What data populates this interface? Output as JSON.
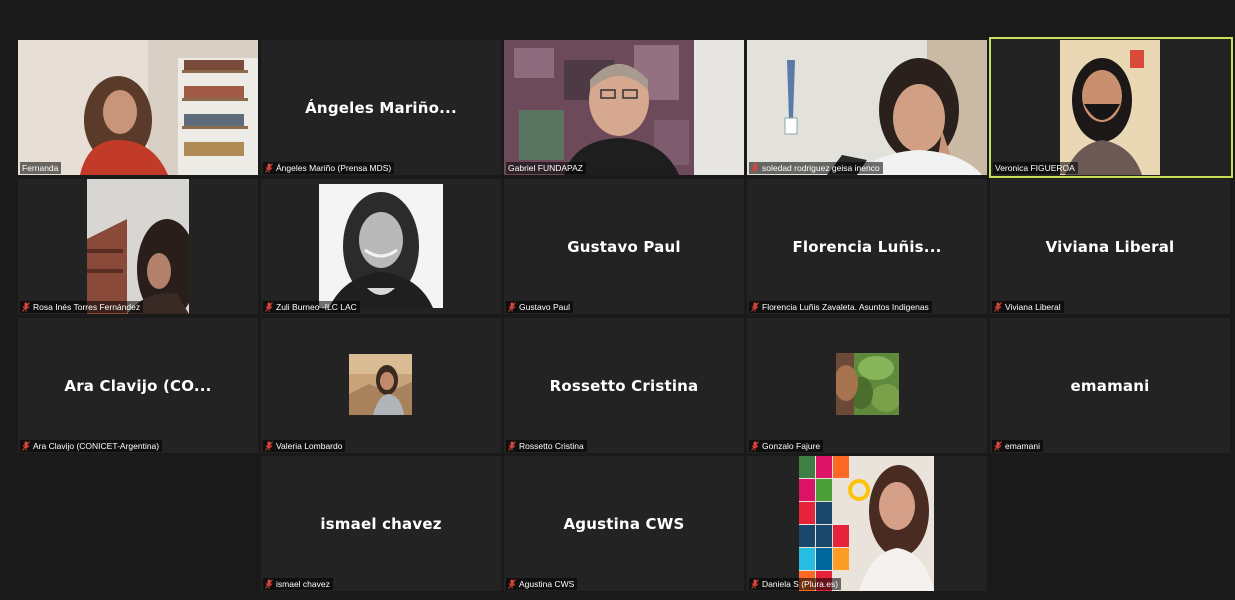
{
  "meeting": {
    "participants": [
      {
        "tile_name": "",
        "label": "Fernanda",
        "muted": false,
        "has_video": true
      },
      {
        "tile_name": "Ángeles  Mariño...",
        "label": "Ángeles Mariño (Prensa MDS)",
        "muted": true,
        "has_video": false
      },
      {
        "tile_name": "",
        "label": "Gabriel FUNDAPAZ",
        "muted": false,
        "has_video": true
      },
      {
        "tile_name": "",
        "label": "soledad rodriguez geisa inenco",
        "muted": true,
        "has_video": true
      },
      {
        "tile_name": "",
        "label": "Veronica FIGUEROA",
        "muted": false,
        "has_video": true,
        "active_speaker": true
      },
      {
        "tile_name": "",
        "label": "Rosa Inés Torres Fernández",
        "muted": true,
        "has_video": true
      },
      {
        "tile_name": "",
        "label": "Zuli Burneo -ILC LAC",
        "muted": true,
        "has_video": true
      },
      {
        "tile_name": "Gustavo Paul",
        "label": "Gustavo Paul",
        "muted": true,
        "has_video": false
      },
      {
        "tile_name": "Florencia  Luñis...",
        "label": "Florencia Luñis Zavaleta. Asuntos Indigenas",
        "muted": true,
        "has_video": false
      },
      {
        "tile_name": "Viviana Liberal",
        "label": "Viviana Liberal",
        "muted": true,
        "has_video": false
      },
      {
        "tile_name": "Ara Clavijo (CO...",
        "label": "Ara Clavijo (CONICET-Argentina)",
        "muted": true,
        "has_video": false
      },
      {
        "tile_name": "",
        "label": "Valeria Lombardo",
        "muted": true,
        "has_video": false,
        "profile_picture": true
      },
      {
        "tile_name": "Rossetto Cristina",
        "label": "Rossetto Cristina",
        "muted": true,
        "has_video": false
      },
      {
        "tile_name": "",
        "label": "Gonzalo Fajure",
        "muted": true,
        "has_video": false,
        "profile_picture": true
      },
      {
        "tile_name": "emamani",
        "label": "emamani",
        "muted": true,
        "has_video": false
      },
      {
        "tile_name": "ismael chavez",
        "label": "ismael chavez",
        "muted": true,
        "has_video": false
      },
      {
        "tile_name": "Agustina CWS",
        "label": "Agustina CWS",
        "muted": true,
        "has_video": false
      },
      {
        "tile_name": "",
        "label": "Daniela S (Plura.es)",
        "muted": true,
        "has_video": false,
        "profile_picture": true
      }
    ]
  },
  "colors": {
    "background": "#1a1a1a",
    "tile": "#232323",
    "active_speaker_border": "#c8df5a",
    "muted_icon": "#e0463c"
  }
}
